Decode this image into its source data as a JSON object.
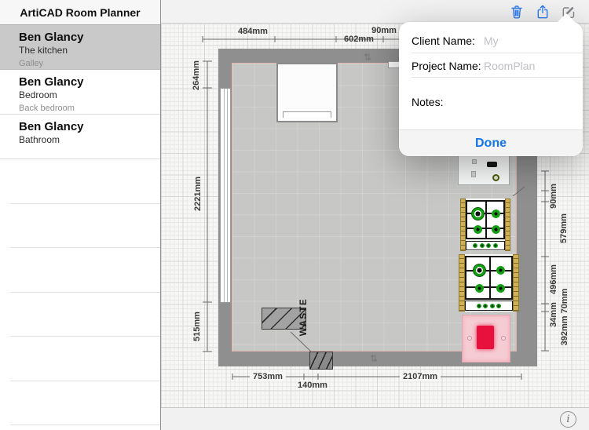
{
  "app": {
    "title": "ArtiCAD Room Planner"
  },
  "sidebar": {
    "items": [
      {
        "client": "Ben Glancy",
        "room": "The kitchen",
        "layout": "Galley",
        "selected": true
      },
      {
        "client": "Ben Glancy",
        "room": "Bedroom",
        "layout": "Back bedroom",
        "selected": false
      },
      {
        "client": "Ben Glancy",
        "room": "Bathroom",
        "layout": "",
        "selected": false
      }
    ]
  },
  "toolbar": {
    "icons": [
      "trash",
      "share",
      "compose"
    ]
  },
  "popover": {
    "client_label": "Client Name:",
    "client_placeholder": "My",
    "project_label": "Project Name:",
    "project_placeholder": "RoomPlan",
    "notes_label": "Notes:",
    "done_label": "Done"
  },
  "plan": {
    "dims": {
      "top": [
        "484mm",
        "602mm",
        "90mm"
      ],
      "left": [
        "264mm",
        "2221mm",
        "515mm"
      ],
      "right": [
        "90mm",
        "579mm",
        "496mm",
        "34mm",
        "392mm 70mm"
      ],
      "bottom": [
        "753mm",
        "140mm",
        "2107mm"
      ]
    },
    "annotations": {
      "waste": "WASTE"
    }
  },
  "statusbar": {
    "info": "i"
  },
  "colors": {
    "accent_blue": "#2f7cf2",
    "done_blue": "#1374e8",
    "selected_gray": "#c9c9c9",
    "wall_gray": "#8f8f8f",
    "floor_gray": "#c7c7c6",
    "burner_green": "#12a012",
    "switch_red": "#e8103c",
    "switch_pink": "#f6ccd3",
    "worktop_yellow": "#d2b156"
  }
}
